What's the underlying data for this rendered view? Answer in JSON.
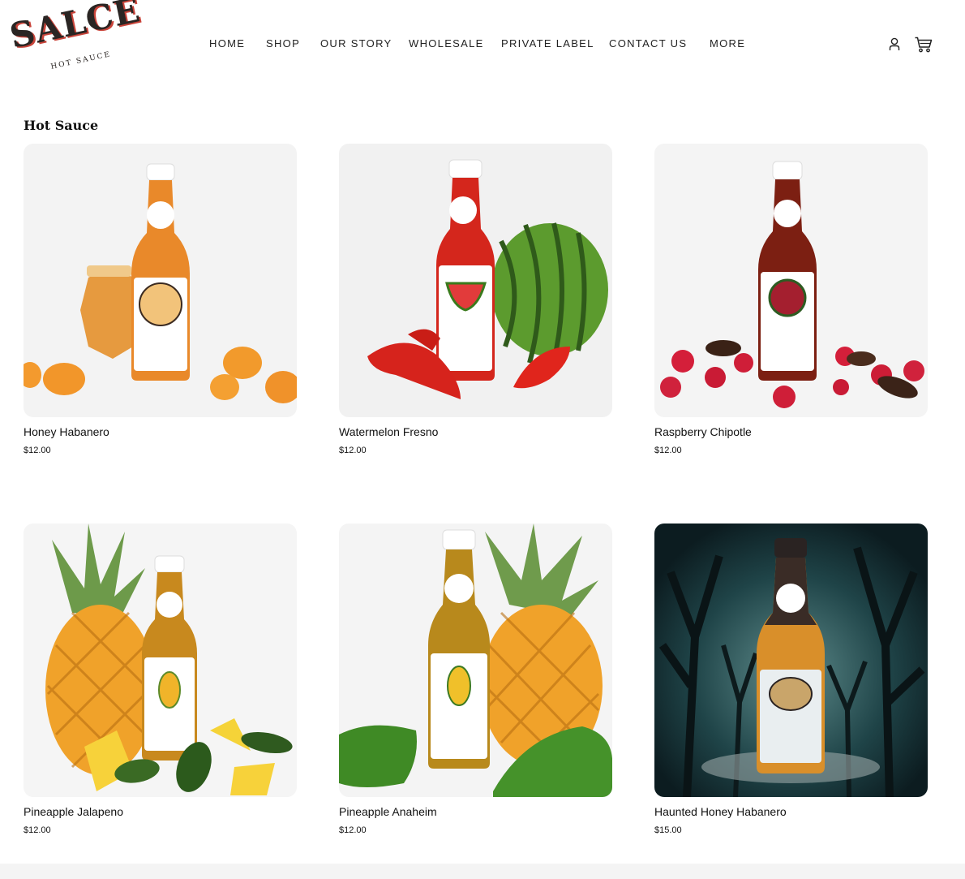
{
  "brand": {
    "name": "SALCE",
    "tagline": "HOT SAUCE"
  },
  "nav": {
    "items": [
      {
        "label": "HOME"
      },
      {
        "label": "SHOP"
      },
      {
        "label": "OUR STORY"
      },
      {
        "label": "WHOLESALE"
      },
      {
        "label": "PRIVATE LABEL"
      },
      {
        "label": "CONTACT US"
      },
      {
        "label": "MORE"
      }
    ]
  },
  "icons": {
    "account": "account-icon",
    "cart": "cart-icon"
  },
  "section": {
    "title": "Hot Sauce"
  },
  "products": [
    {
      "name": "Honey Habanero",
      "price": "$12.00",
      "bg": "#f3f3f3",
      "sauce": "#e9892a"
    },
    {
      "name": "Watermelon Fresno",
      "price": "$12.00",
      "bg": "#f1f1f1",
      "sauce": "#d4261c"
    },
    {
      "name": "Raspberry Chipotle",
      "price": "$12.00",
      "bg": "#f4f4f4",
      "sauce": "#7c1f12"
    },
    {
      "name": "Pineapple Jalapeno",
      "price": "$12.00",
      "bg": "#f5f5f5",
      "sauce": "#c8891e"
    },
    {
      "name": "Pineapple Anaheim",
      "price": "$12.00",
      "bg": "#f4f4f4",
      "sauce": "#b8891c"
    },
    {
      "name": "Haunted Honey Habanero",
      "price": "$15.00",
      "bg": "#1f3a40",
      "sauce": "#d98f2a"
    }
  ]
}
